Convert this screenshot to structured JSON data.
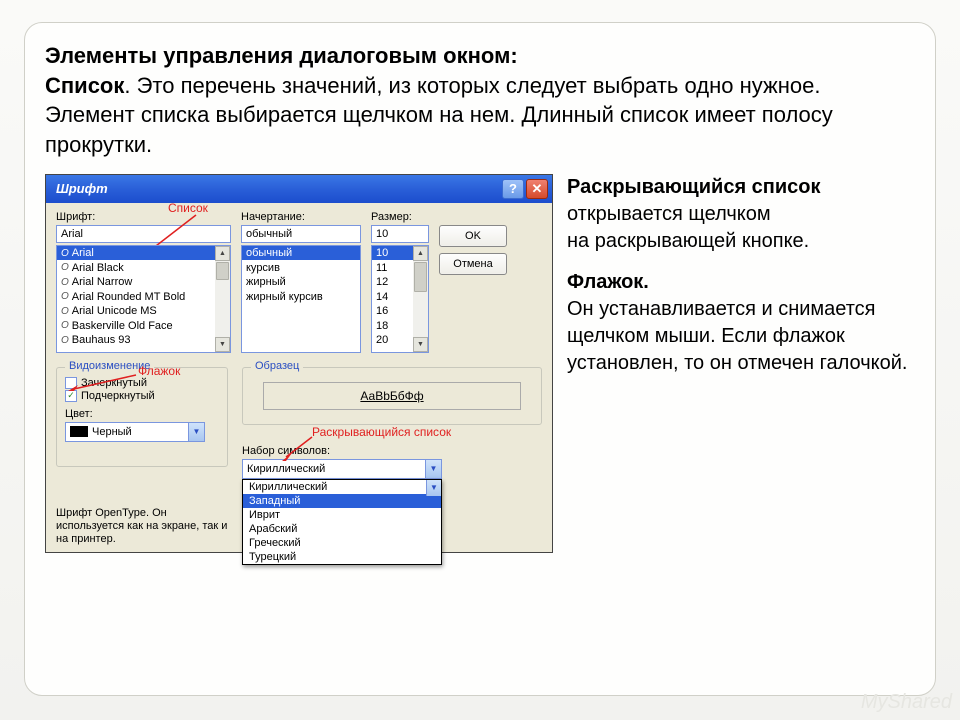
{
  "headline": {
    "title": "Элементы управления диалоговым окном:",
    "list_label": "Список",
    "body": ". Это перечень значений, из которых следует выбрать одно нужное. Элемент списка выбирается щелчком на нем. Длинный список имеет полосу прокрутки."
  },
  "side": {
    "p1_bold": "Раскрывающийся список",
    "p1_rest": " открывается щелчком",
    "p1_line2": " на раскрывающей кнопке.",
    "p2_bold": "Флажок.",
    "p2_body": "Он устанавливается и снимается щелчком мыши. Если флажок установлен, то он отмечен галочкой."
  },
  "dialog": {
    "title": "Шрифт",
    "help_glyph": "?",
    "close_glyph": "✕",
    "font_label": "Шрифт:",
    "style_label": "Начертание:",
    "size_label": "Размер:",
    "font_value": "Arial",
    "style_value": "обычный",
    "size_value": "10",
    "ok": "OK",
    "cancel": "Отмена",
    "fonts": [
      "Arial",
      "Arial Black",
      "Arial Narrow",
      "Arial Rounded MT Bold",
      "Arial Unicode MS",
      "Baskerville Old Face",
      "Bauhaus 93"
    ],
    "styles": [
      "обычный",
      "курсив",
      "жирный",
      "жирный курсив"
    ],
    "sizes": [
      "10",
      "11",
      "12",
      "14",
      "16",
      "18",
      "20"
    ],
    "group_modify": "Видоизменение",
    "chk_strike": "Зачеркнутый",
    "chk_underline": "Подчеркнутый",
    "color_label": "Цвет:",
    "color_value": "Черный",
    "group_sample": "Образец",
    "sample_text": "АаBbБбФф",
    "charset_label": "Набор символов:",
    "charset_options": [
      "Кириллический",
      "Кириллический",
      "Западный",
      "Иврит",
      "Арабский",
      "Греческий",
      "Турецкий"
    ],
    "footer": "Шрифт OpenType. Он используется как на экране, так и на принтер.",
    "annot_list": "Список",
    "annot_flag": "Флажок",
    "annot_dropdown": "Раскрывающийся список"
  },
  "watermark": "MyShared"
}
